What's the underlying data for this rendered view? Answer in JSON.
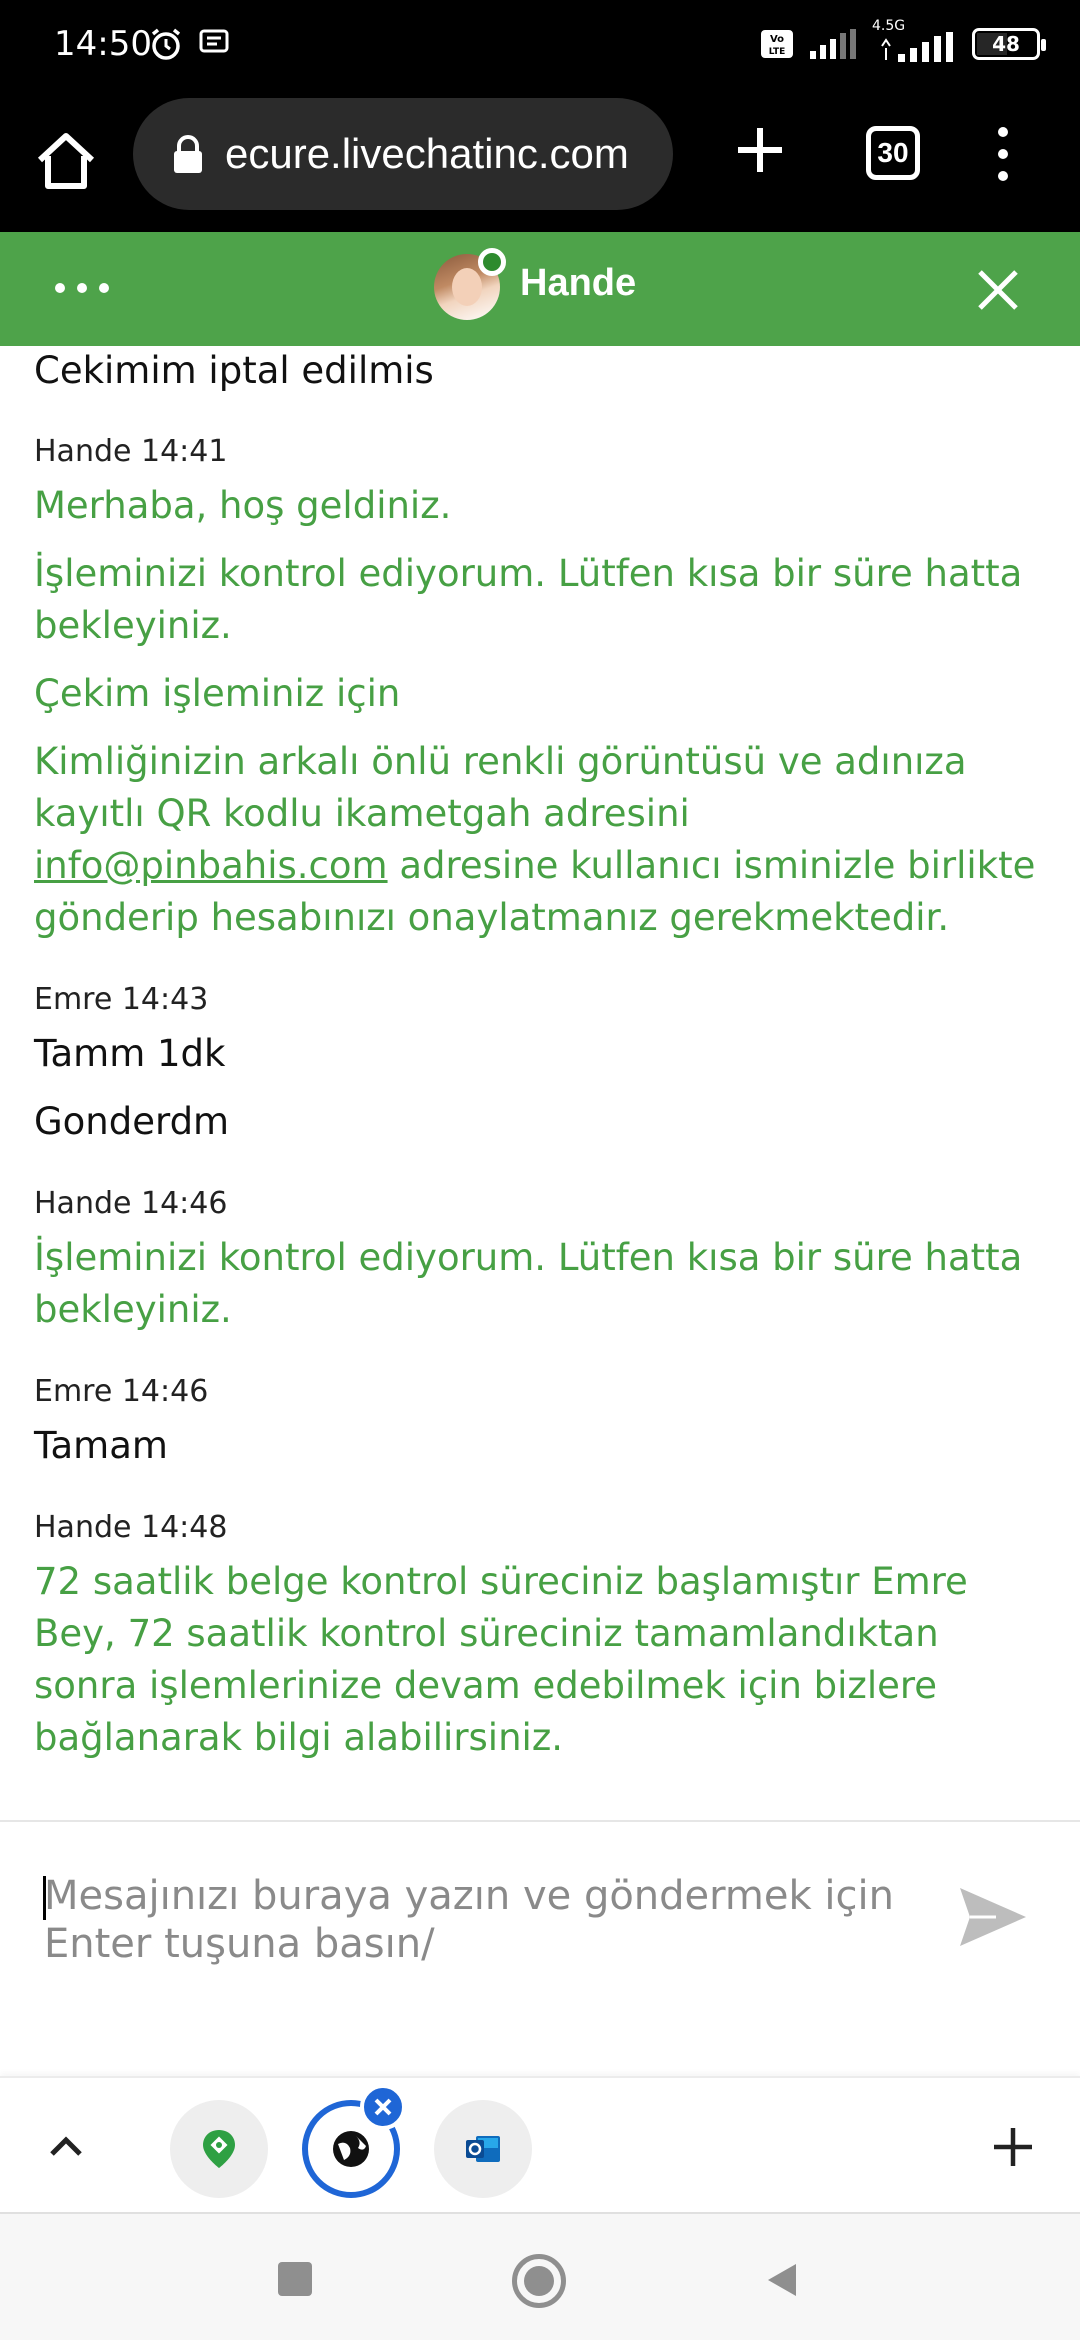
{
  "status_bar": {
    "time": "14:50",
    "network": "4.5G",
    "battery": "48"
  },
  "browser": {
    "url": "ecure.livechatinc.com",
    "tab_count": "30"
  },
  "chat": {
    "agent_name": "Hande",
    "top_partial_message": "Cekimim iptal edilmis",
    "messages": [
      {
        "meta": "Hande 14:41",
        "role": "agent",
        "lines": [
          "Merhaba, hoş geldiniz.",
          "İşleminizi kontrol ediyorum. Lütfen kısa bir süre hatta bekleyiniz.",
          "Çekim işleminiz için"
        ],
        "line_with_link": {
          "before": "Kimliğinizin arkalı önlü renkli görüntüsü ve adınıza kayıtlı QR kodlu ikametgah adresini ",
          "link": "info@pinbahis.com",
          "after": " adresine kullanıcı isminizle birlikte gönderip hesabınızı onaylatmanız gerekmektedir."
        }
      },
      {
        "meta": "Emre 14:43",
        "role": "user",
        "lines": [
          "Tamm 1dk",
          "Gonderdm"
        ]
      },
      {
        "meta": "Hande 14:46",
        "role": "agent",
        "lines": [
          "İşleminizi kontrol ediyorum. Lütfen kısa bir süre hatta bekleyiniz."
        ]
      },
      {
        "meta": "Emre 14:46",
        "role": "user",
        "lines": [
          "Tamam"
        ]
      },
      {
        "meta": "Hande 14:48",
        "role": "agent",
        "lines": [
          "72 saatlik belge kontrol süreciniz başlamıştır Emre Bey, 72 saatlik kontrol süreciniz tamamlandıktan sonra işlemlerinize devam edebilmek için bizlere bağlanarak bilgi alabilirsiniz."
        ]
      }
    ]
  },
  "input": {
    "placeholder": "Mesajınızı buraya yazın ve göndermek için Enter tuşuna basın/"
  },
  "colors": {
    "header_green": "#4ea34a",
    "agent_text_green": "#47a044",
    "bubble_blue": "#1f66d6"
  },
  "icons": {
    "bubble_1": "map-pin-icon",
    "bubble_2": "globe-icon",
    "bubble_3": "outlook-icon"
  }
}
